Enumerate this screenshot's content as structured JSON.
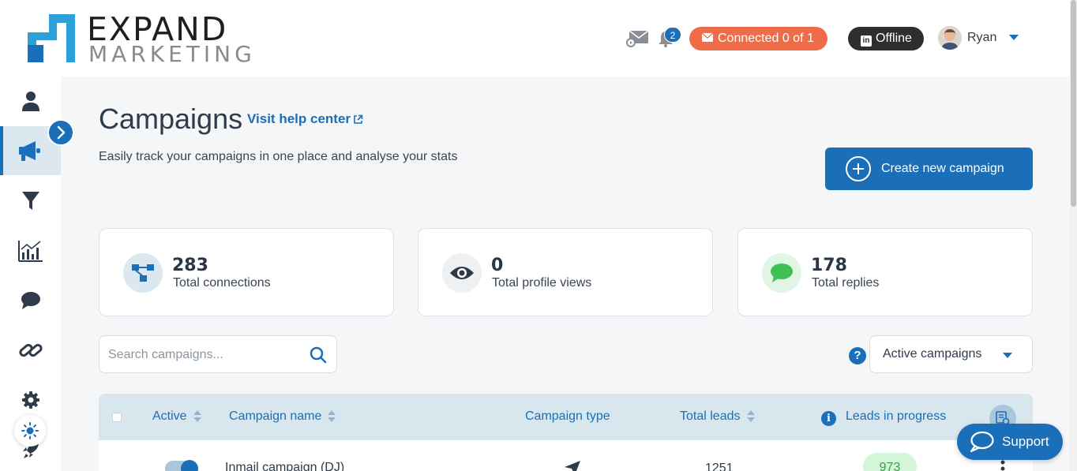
{
  "header": {
    "logo_line1": "EXPAND",
    "logo_line2": "MARKETING",
    "notification_count": "2",
    "connected_label": "Connected 0 of 1",
    "linkedin_status": "Offline",
    "user_name": "Ryan",
    "icons": [
      "mail-icon",
      "bell-icon",
      "envelope-icon",
      "linkedin-icon",
      "chevron-down-icon"
    ]
  },
  "sidebar": {
    "items": [
      {
        "icon": "user-icon"
      },
      {
        "icon": "megaphone-icon",
        "active": true
      },
      {
        "icon": "filter-icon"
      },
      {
        "icon": "analytics-icon"
      },
      {
        "icon": "chat-icon"
      },
      {
        "icon": "link-icon"
      },
      {
        "icon": "gear-icon"
      },
      {
        "icon": "rocket-icon"
      }
    ],
    "theme_toggle_icon": "sun-icon",
    "expand_icon": "chevron-right-icon"
  },
  "main": {
    "title": "Campaigns",
    "help_link": "Visit help center",
    "subtitle": "Easily track your campaigns in one place and analyse your stats",
    "create_button": "Create new campaign"
  },
  "stats": [
    {
      "value": "283",
      "label": "Total connections",
      "icon": "network-icon",
      "color": "#1b6eb8"
    },
    {
      "value": "0",
      "label": "Total profile views",
      "icon": "eye-icon",
      "color": "#2f3b4a"
    },
    {
      "value": "178",
      "label": "Total replies",
      "icon": "speech-bubble-icon",
      "color": "#3fbf55"
    }
  ],
  "search": {
    "placeholder": "Search campaigns...",
    "value": ""
  },
  "filter": {
    "selected": "Active campaigns"
  },
  "table": {
    "columns": [
      "Active",
      "Campaign name",
      "Campaign type",
      "Total leads",
      "Leads in progress"
    ],
    "rows": [
      {
        "active": true,
        "name": "Inmail campaign (DJ)",
        "type_icon": "paper-plane-icon",
        "total_leads": "1251",
        "leads_in_progress": "973"
      }
    ]
  },
  "support": {
    "label": "Support"
  },
  "colors": {
    "primary": "#1b6eb8",
    "connected_pill": "#f06c48",
    "offline_pill": "#2e2e2e",
    "progress_badge": "#d5f5d9"
  }
}
